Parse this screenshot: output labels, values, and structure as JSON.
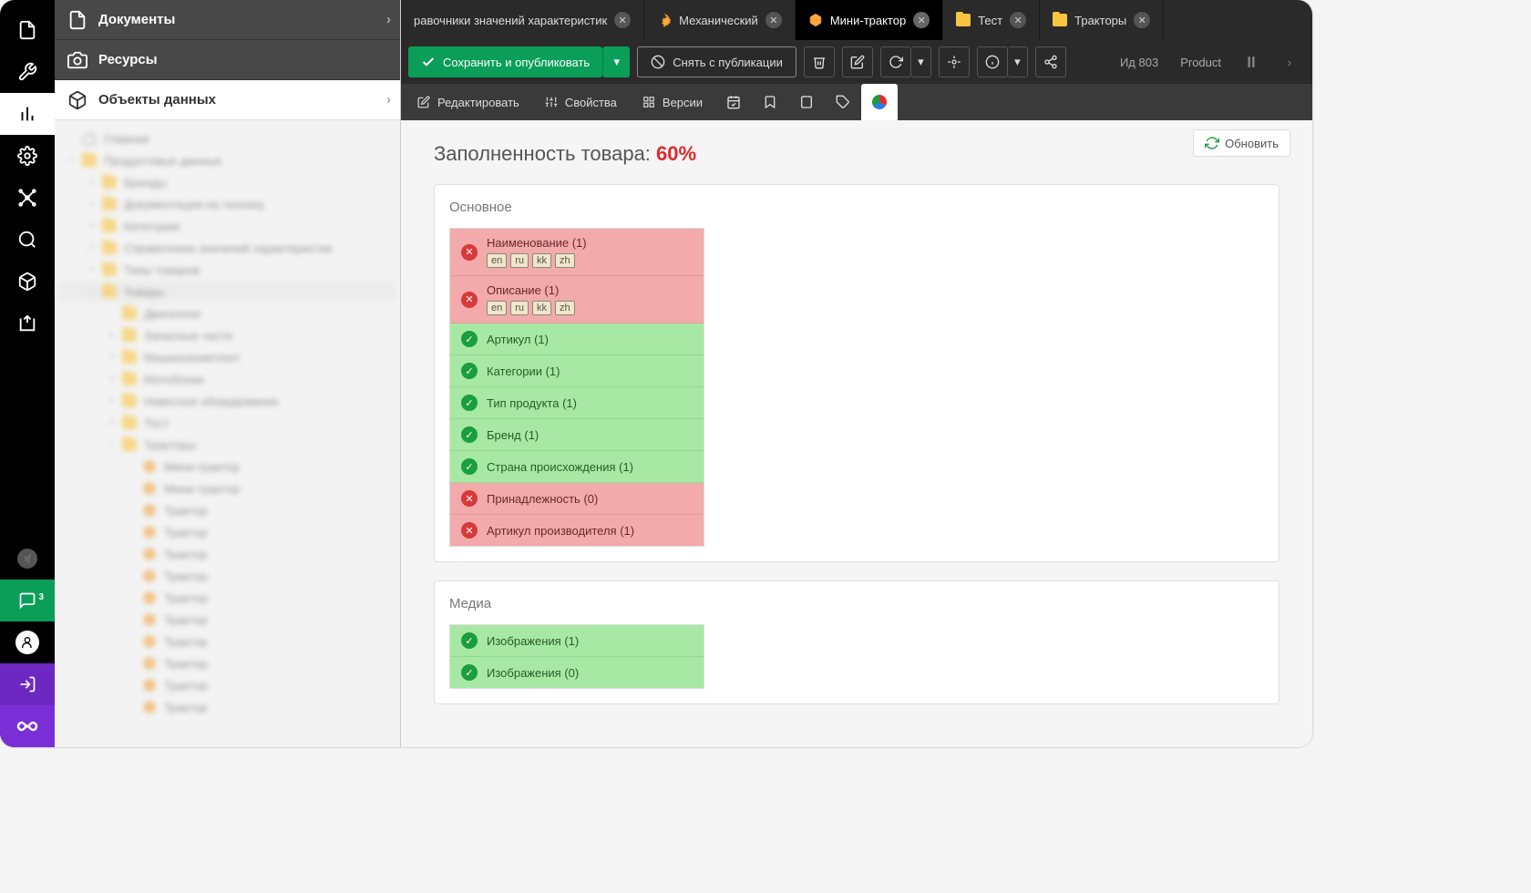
{
  "iconbar": {
    "sf_badge": "sf",
    "chat_badge": "3"
  },
  "sidepanel": {
    "documents": "Документы",
    "resources": "Ресурсы",
    "data_objects": "Объекты данных",
    "tree": [
      {
        "indent": 0,
        "icon": "home",
        "label": "Главная"
      },
      {
        "indent": 0,
        "icon": "folder",
        "label": "Продуктовые данные",
        "expand": "−"
      },
      {
        "indent": 1,
        "icon": "folder",
        "label": "Бренды",
        "expand": "+"
      },
      {
        "indent": 1,
        "icon": "folder",
        "label": "Документация на технику",
        "expand": "+"
      },
      {
        "indent": 1,
        "icon": "folder",
        "label": "Категории",
        "expand": "+"
      },
      {
        "indent": 1,
        "icon": "folder",
        "label": "Справочники значений характеристик",
        "expand": "+"
      },
      {
        "indent": 1,
        "icon": "folder",
        "label": "Типы товаров",
        "expand": "+"
      },
      {
        "indent": 1,
        "icon": "folder",
        "label": "Товары",
        "expand": "−",
        "sel": true
      },
      {
        "indent": 2,
        "icon": "folder",
        "label": "Двигатели"
      },
      {
        "indent": 2,
        "icon": "folder",
        "label": "Запасные части",
        "expand": "+"
      },
      {
        "indent": 2,
        "icon": "folder",
        "label": "Машинокомплект",
        "expand": "+"
      },
      {
        "indent": 2,
        "icon": "folder",
        "label": "Мотоблоки",
        "expand": "+"
      },
      {
        "indent": 2,
        "icon": "folder",
        "label": "Навесное оборудование",
        "expand": "+"
      },
      {
        "indent": 2,
        "icon": "folder",
        "label": "Тест",
        "expand": "+"
      },
      {
        "indent": 2,
        "icon": "folder",
        "label": "Тракторы",
        "expand": "−"
      },
      {
        "indent": 3,
        "icon": "box",
        "label": "Мини-трактор"
      },
      {
        "indent": 3,
        "icon": "box",
        "label": "Мини-трактор"
      },
      {
        "indent": 3,
        "icon": "box",
        "label": "Трактор"
      },
      {
        "indent": 3,
        "icon": "box",
        "label": "Трактор"
      },
      {
        "indent": 3,
        "icon": "box",
        "label": "Трактор"
      },
      {
        "indent": 3,
        "icon": "box",
        "label": "Трактор"
      },
      {
        "indent": 3,
        "icon": "box",
        "label": "Трактор"
      },
      {
        "indent": 3,
        "icon": "box",
        "label": "Трактор"
      },
      {
        "indent": 3,
        "icon": "box",
        "label": "Трактор"
      },
      {
        "indent": 3,
        "icon": "box",
        "label": "Трактор"
      },
      {
        "indent": 3,
        "icon": "box",
        "label": "Трактор"
      },
      {
        "indent": 3,
        "icon": "box",
        "label": "Трактор"
      }
    ]
  },
  "tabs": [
    {
      "icon": "none",
      "label": "равочники значений характеристик",
      "active": false
    },
    {
      "icon": "gear",
      "label": "Механический",
      "active": false
    },
    {
      "icon": "box",
      "label": "Мини-трактор",
      "active": true
    },
    {
      "icon": "folder",
      "label": "Тест",
      "active": false
    },
    {
      "icon": "folder",
      "label": "Тракторы",
      "active": false
    }
  ],
  "toolbar": {
    "save": "Сохранить и опубликовать",
    "unpublish": "Снять с публикации",
    "id_label": "Ид 803",
    "type_label": "Product"
  },
  "subtabs": {
    "edit": "Редактировать",
    "properties": "Свойства",
    "versions": "Версии"
  },
  "content": {
    "refresh": "Обновить",
    "completeness_label": "Заполненность товара: ",
    "completeness_pct": "60%",
    "groups": [
      {
        "title": "Основное",
        "fields": [
          {
            "status": "fail",
            "label": "Наименование (1)",
            "langs": [
              "en",
              "ru",
              "kk",
              "zh"
            ]
          },
          {
            "status": "fail",
            "label": "Описание (1)",
            "langs": [
              "en",
              "ru",
              "kk",
              "zh"
            ]
          },
          {
            "status": "ok",
            "label": "Артикул (1)"
          },
          {
            "status": "ok",
            "label": "Категории (1)"
          },
          {
            "status": "ok",
            "label": "Тип продукта (1)"
          },
          {
            "status": "ok",
            "label": "Бренд (1)"
          },
          {
            "status": "ok",
            "label": "Страна происхождения (1)"
          },
          {
            "status": "fail",
            "label": "Принадлежность (0)"
          },
          {
            "status": "fail",
            "label": "Артикул производителя (1)"
          }
        ]
      },
      {
        "title": "Медиа",
        "fields": [
          {
            "status": "ok",
            "label": "Изображения (1)"
          },
          {
            "status": "ok",
            "label": "Изображения (0)"
          }
        ]
      }
    ]
  }
}
